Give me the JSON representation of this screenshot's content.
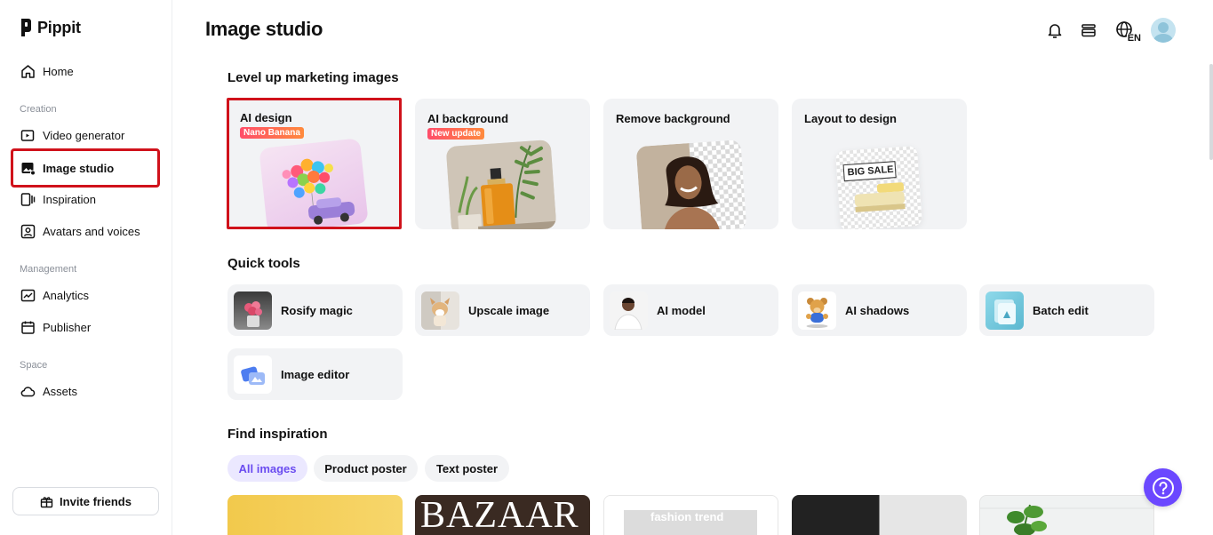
{
  "app": {
    "name": "Pippit"
  },
  "sidebar": {
    "home": "Home",
    "creation_label": "Creation",
    "video_generator": "Video generator",
    "image_studio": "Image studio",
    "inspiration": "Inspiration",
    "avatars_voices": "Avatars and voices",
    "management_label": "Management",
    "analytics": "Analytics",
    "publisher": "Publisher",
    "space_label": "Space",
    "assets": "Assets",
    "invite": "Invite friends"
  },
  "header": {
    "title": "Image studio",
    "language": "EN"
  },
  "marketing": {
    "title": "Level up marketing images",
    "cards": [
      {
        "title": "AI design",
        "badge": "Nano Banana"
      },
      {
        "title": "AI background",
        "badge": "New update"
      },
      {
        "title": "Remove background"
      },
      {
        "title": "Layout to design",
        "sale_text": "BIG SALE"
      }
    ]
  },
  "quick_tools": {
    "title": "Quick tools",
    "items": [
      "Rosify magic",
      "Upscale image",
      "AI model",
      "AI shadows",
      "Batch edit",
      "Image editor"
    ]
  },
  "inspiration": {
    "title": "Find inspiration",
    "filters": [
      "All images",
      "Product poster",
      "Text poster"
    ],
    "active_filter": "All images",
    "card_texts": [
      "BAZAAR",
      "fashion trend"
    ]
  },
  "colors": {
    "accent": "#6b48ff",
    "highlight": "#d0121b",
    "card_bg": "#f2f3f5"
  }
}
